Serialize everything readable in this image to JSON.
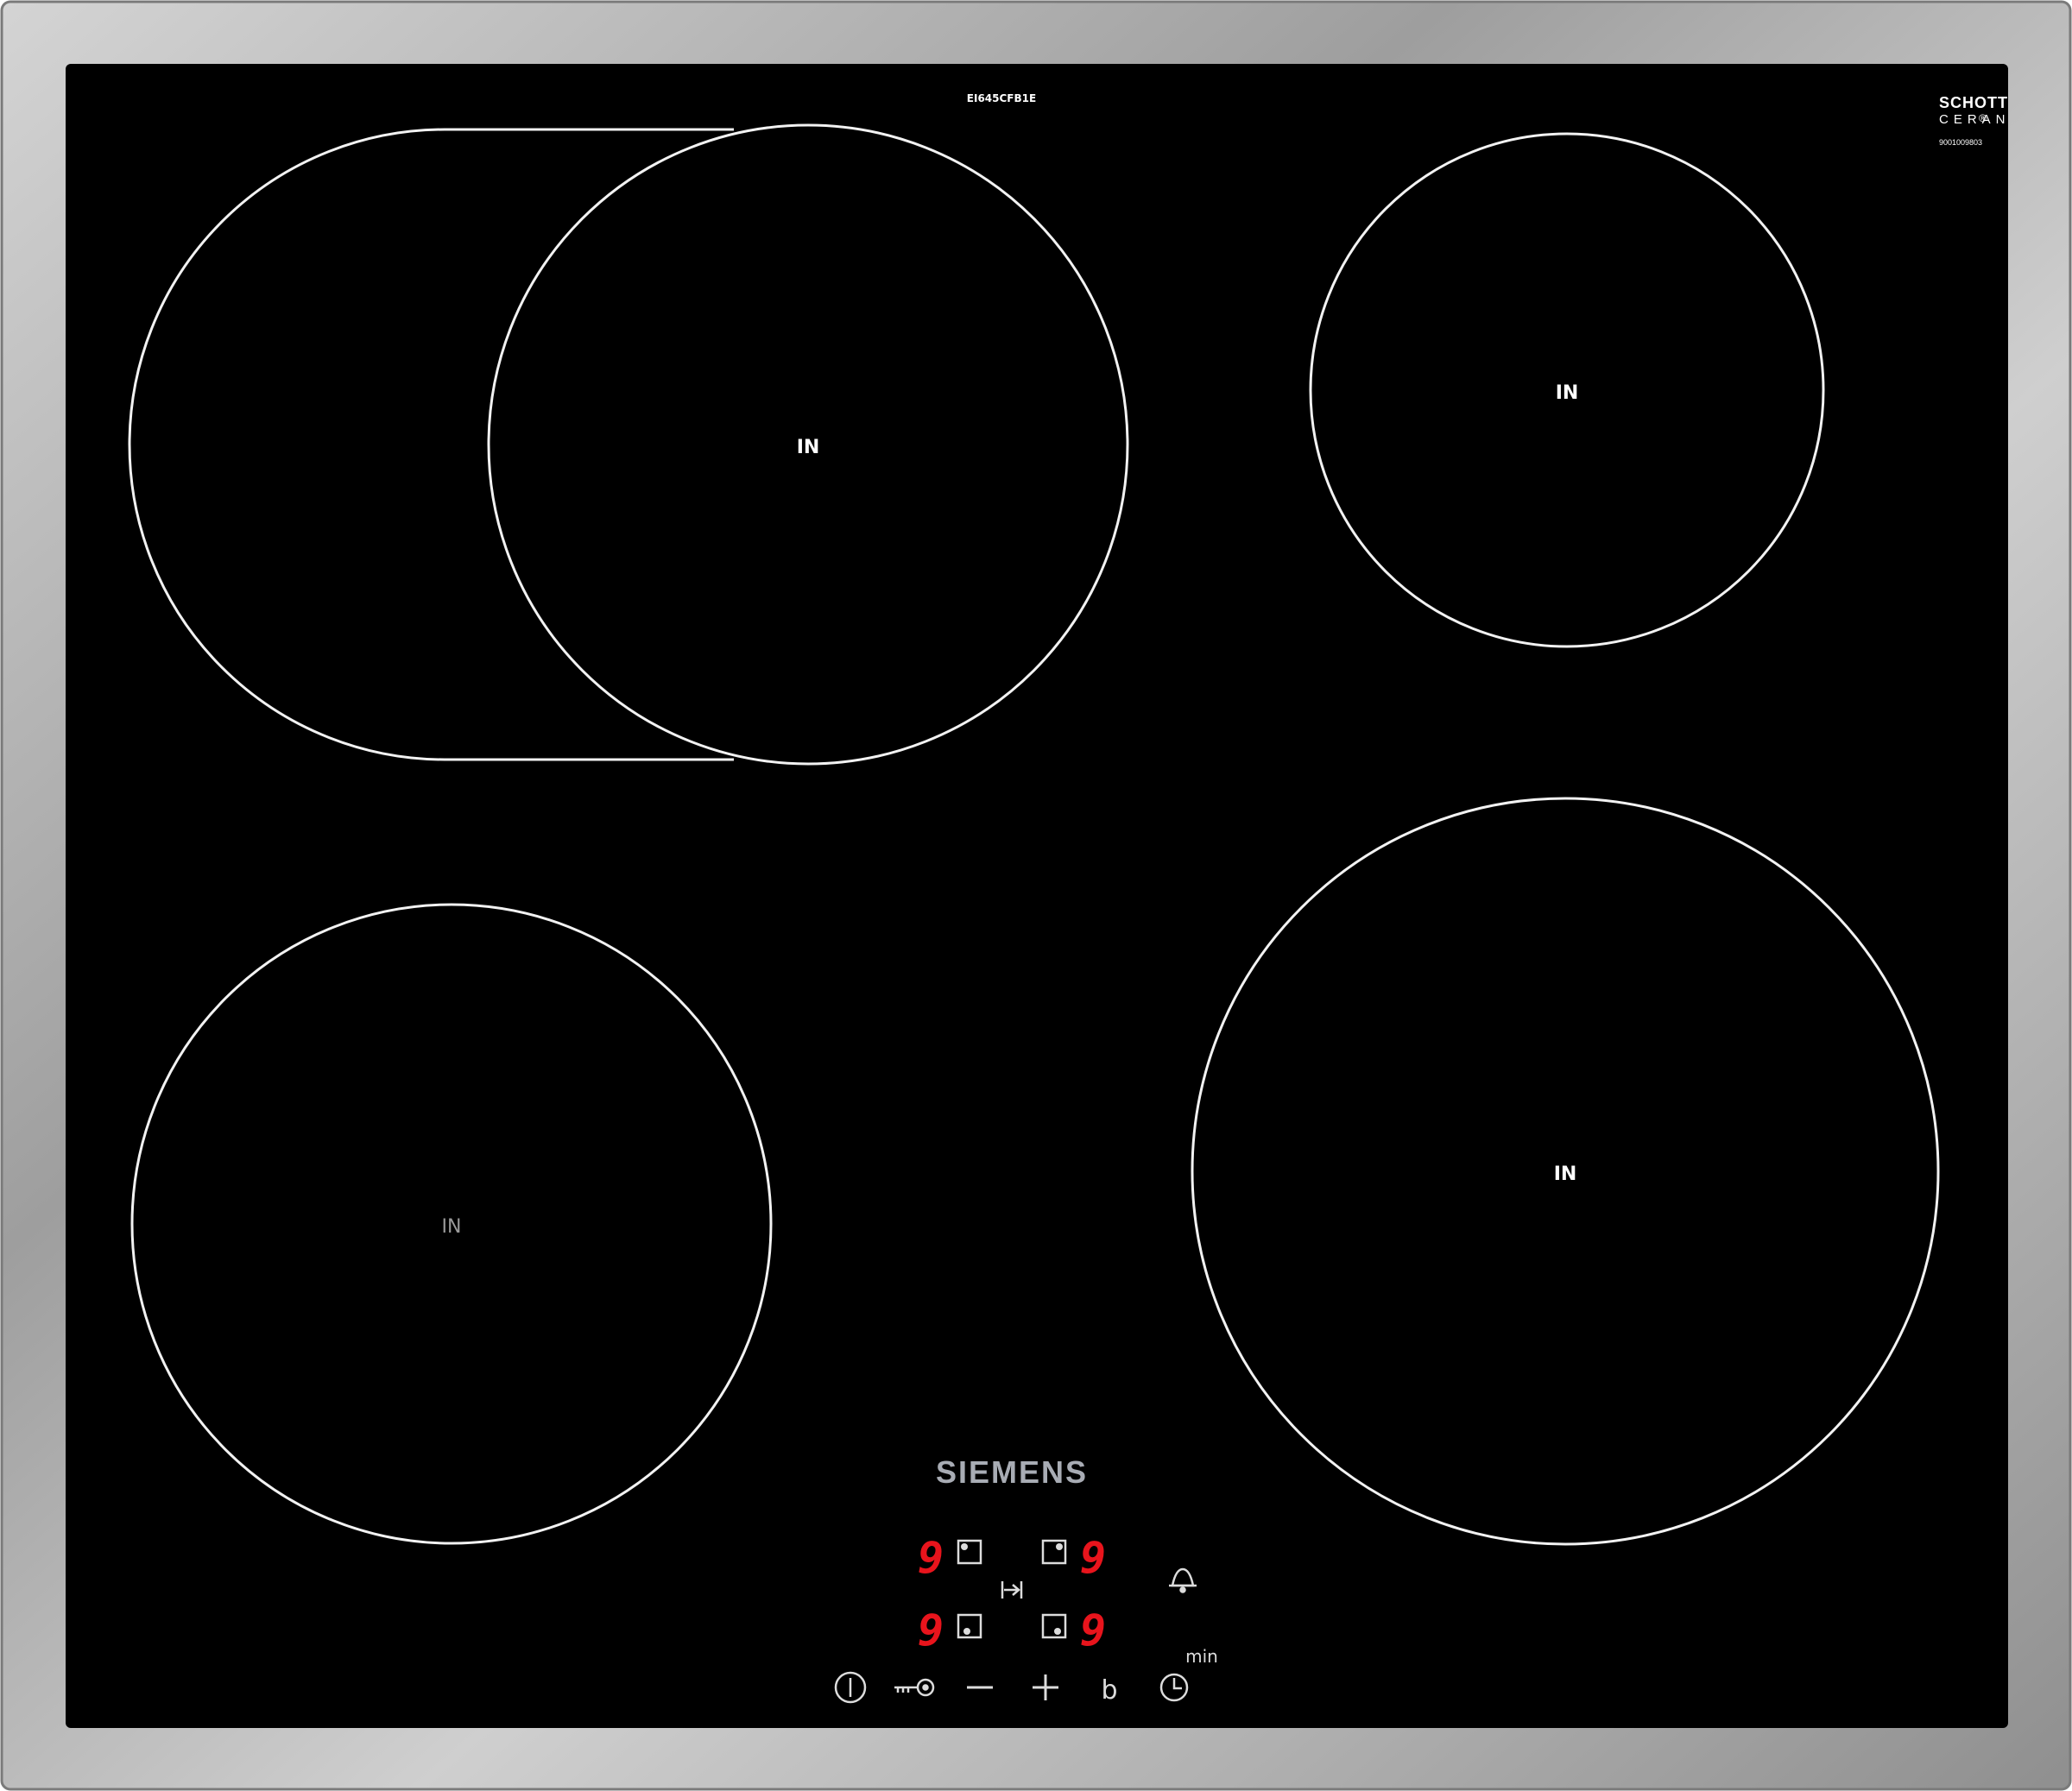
{
  "model_code": "EI645CFB1E",
  "glass_brand": {
    "line1": "SCHOTT",
    "line2": "CERAN",
    "mark": "®",
    "serial": "9001009803"
  },
  "zones": [
    {
      "label": "IN"
    },
    {
      "label": "IN"
    },
    {
      "label": "IN"
    },
    {
      "label": "IN"
    }
  ],
  "brand_logo": "SIEMENS",
  "display": {
    "digits": [
      "9",
      "9",
      "9",
      "9"
    ],
    "digit_color": "#e8141c"
  },
  "controls": {
    "min_label": "min",
    "boost_symbol": "b",
    "minus_symbol": "—",
    "plus_symbol": "+"
  },
  "colors": {
    "glass": "#000000",
    "frame": "#b8b8b8",
    "line": "#f2f2f2",
    "logo": "#a8acb4"
  },
  "icons": [
    "power-icon",
    "key-lock-icon",
    "minus-icon",
    "plus-icon",
    "boost-icon",
    "timer-icon",
    "alarm-bell-icon",
    "zone-select-icon",
    "zone-indicator-icon"
  ]
}
